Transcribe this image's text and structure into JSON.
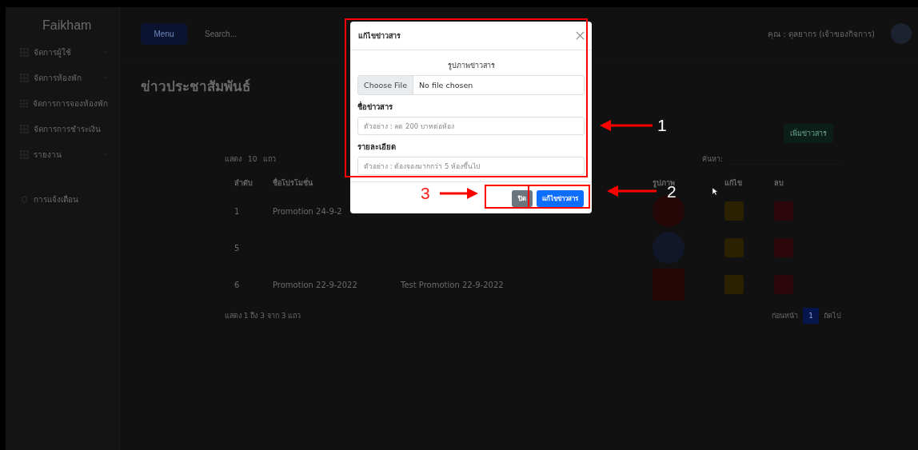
{
  "sidebar": {
    "logo": "Faikham",
    "sections": [
      {
        "items": [
          {
            "label": "จัดการผู้ใช้",
            "expandable": true
          },
          {
            "label": "จัดการห้องพัก",
            "expandable": true
          },
          {
            "label": "จัดการการจองห้องพัก",
            "expandable": false
          },
          {
            "label": "จัดการการชำระเงิน",
            "expandable": false
          },
          {
            "label": "รายงาน",
            "expandable": true
          }
        ]
      },
      {
        "items": [
          {
            "label": "การแจ้งเตือน",
            "expandable": false
          }
        ]
      }
    ]
  },
  "topbar": {
    "menu_button": "Menu",
    "search": {
      "placeholder": "Search..."
    },
    "user": "คุณ : ดุลยากร (เจ้าของกิจการ)"
  },
  "page": {
    "title": "ข่าวประชาสัมพันธ์",
    "add_button": "เพิ่มข่าวสาร",
    "length": {
      "prefix": "แสดง",
      "value": "10",
      "suffix": "แถว"
    },
    "search_label": "ค้นหา:",
    "columns": [
      "ลำดับ",
      "ชื่อโปรโมชั่น",
      "รูปภาพ",
      "แก้ไข",
      "ลบ"
    ],
    "rows": [
      {
        "index": "1",
        "name": "Promotion 24-9-2"
      },
      {
        "index": "5"
      },
      {
        "index": "6",
        "name": "Promotion 22-9-2022",
        "detail": "Test Promotion 22-9-2022"
      }
    ],
    "info": "แสดง 1 ถึง 3 จาก 3 แถว",
    "pagination": {
      "previous": "ก่อนหน้า",
      "pages": [
        {
          "label": "1",
          "selected": true
        }
      ],
      "next": "ถัดไป"
    }
  },
  "modal": {
    "title": "แก้ไขข่าวสาร",
    "image_label": "รูปภาพข่าวสาร",
    "file_button": "Choose File",
    "file_status": "No file chosen",
    "fields": [
      {
        "label": "ชื่อข่าวสาร",
        "placeholder": "ตัวอย่าง : ลด 200 บาทต่อห้อง"
      },
      {
        "label": "รายละเอียด",
        "placeholder": "ตัวอย่าง : ต้องจองมากกว่า 5 ห้องขึ้นไป"
      }
    ],
    "close_button": "ปิด",
    "submit_button": "แก้ไขข่าวสาร"
  },
  "annotations": [
    {
      "number": "1",
      "color": "#ffffff"
    },
    {
      "number": "2",
      "color": "#ffffff"
    },
    {
      "number": "3",
      "color": "#ff1a1a"
    }
  ]
}
